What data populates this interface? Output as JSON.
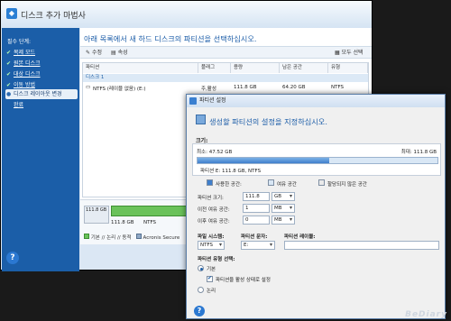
{
  "main_window": {
    "title": "디스크 추가 마법사",
    "sidebar": {
      "header": "필수 단계:",
      "items": [
        {
          "label": "복제 모드",
          "done": true
        },
        {
          "label": "원본 디스크",
          "done": true
        },
        {
          "label": "대상 디스크",
          "done": true
        },
        {
          "label": "이동 방법",
          "done": true
        },
        {
          "label": "디스크 레이아웃 변경",
          "active": true
        },
        {
          "label": "완료",
          "done": false
        }
      ]
    },
    "heading": "아래 목록에서 새 하드 디스크의 파티션을 선택하십시오.",
    "toolbar": {
      "edit": "수정",
      "properties": "속성",
      "select_all": "모두 선택"
    },
    "table": {
      "columns": [
        "파티션",
        "플래그",
        "용량",
        "남은 공간",
        "유형"
      ],
      "group": "디스크 1",
      "rows": [
        {
          "partition": "NTFS (레이블 없음) (E:)",
          "flag": "주,활성",
          "capacity": "111.8 GB",
          "free": "64.20 GB",
          "type": "NTFS"
        }
      ]
    },
    "disk_map": {
      "size": "111.8 GB",
      "fs": "NTFS",
      "icon_label": "111.8 GB"
    },
    "legend": {
      "basic": "기본 // 논리 // 동적",
      "acronis": "Acronis Secure"
    }
  },
  "dialog": {
    "title": "파티션 설정",
    "heading": "생성할 파티션의 설정을 지정하십시오.",
    "size_label": "크기:",
    "min_label": "최소: 47.52 GB",
    "max_label": "최대: 111.8 GB",
    "partition_caption": "파티션 E: 111.8 GB, NTFS",
    "slider_fill_fraction": 0.55,
    "legend": {
      "used": "사용한 공간:",
      "free": "여유 공간",
      "unallocated": "할당되지 않은 공간"
    },
    "fields": {
      "partition_size_label": "파티션 크기:",
      "partition_size_value": "111.8",
      "partition_size_unit": "GB",
      "before_label": "이전 여유 공간:",
      "before_value": "1",
      "before_unit": "MB",
      "after_label": "이후 여유 공간:",
      "after_value": "0",
      "after_unit": "MB"
    },
    "fs_label": "파일 시스템:",
    "fs_value": "NTFS",
    "letter_label": "파티션 문자:",
    "letter_value": "E:",
    "volume_label": "파티션 레이블:",
    "volume_value": "",
    "type_label": "파티션 유형 선택:",
    "type_primary": "기본",
    "type_active": "파티션을 활성 상태로 설정",
    "type_logical": "논리"
  },
  "watermark": "BeDiary",
  "colors": {
    "accent": "#1c5da8",
    "sidebar": "#1b5ea8",
    "disk_green": "#6ac25a"
  }
}
